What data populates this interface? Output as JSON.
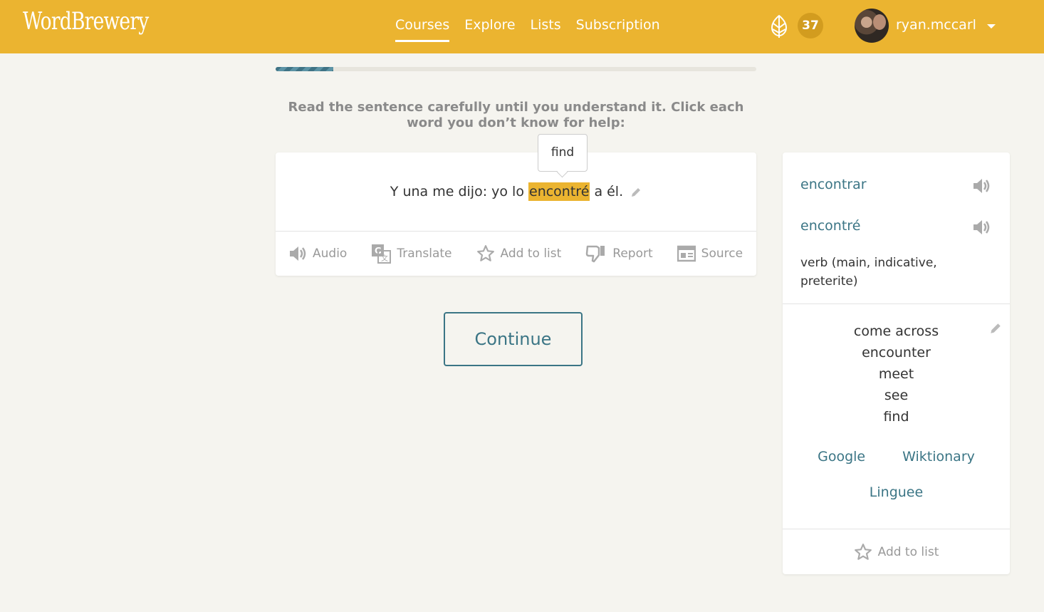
{
  "header": {
    "logo": "WordBrewery",
    "nav": [
      "Courses",
      "Explore",
      "Lists",
      "Subscription"
    ],
    "active_nav": "Courses",
    "points": "37",
    "username": "ryan.mccarl"
  },
  "lesson": {
    "progress_fraction": 0.12,
    "instructions": "Read the sentence carefully until you understand it. Click each word you don’t know for help:",
    "sentence": {
      "before": "Y una me dijo: yo lo",
      "highlighted": "encontré",
      "after": "a él."
    },
    "tooltip": "find",
    "actions": {
      "audio": "Audio",
      "translate": "Translate",
      "add_to_list": "Add to list",
      "report": "Report",
      "source": "Source"
    },
    "continue_label": "Continue"
  },
  "panel": {
    "lemma": "encontrar",
    "form": "encontré",
    "grammar": "verb (main, indicative, preterite)",
    "translations": [
      "come across",
      "encounter",
      "meet",
      "see",
      "find"
    ],
    "links": {
      "google": "Google",
      "wiktionary": "Wiktionary",
      "linguee": "Linguee"
    },
    "add_to_list": "Add to list"
  },
  "colors": {
    "header": "#ebb430",
    "accent": "#3b7585",
    "background": "#f5f4ef"
  }
}
